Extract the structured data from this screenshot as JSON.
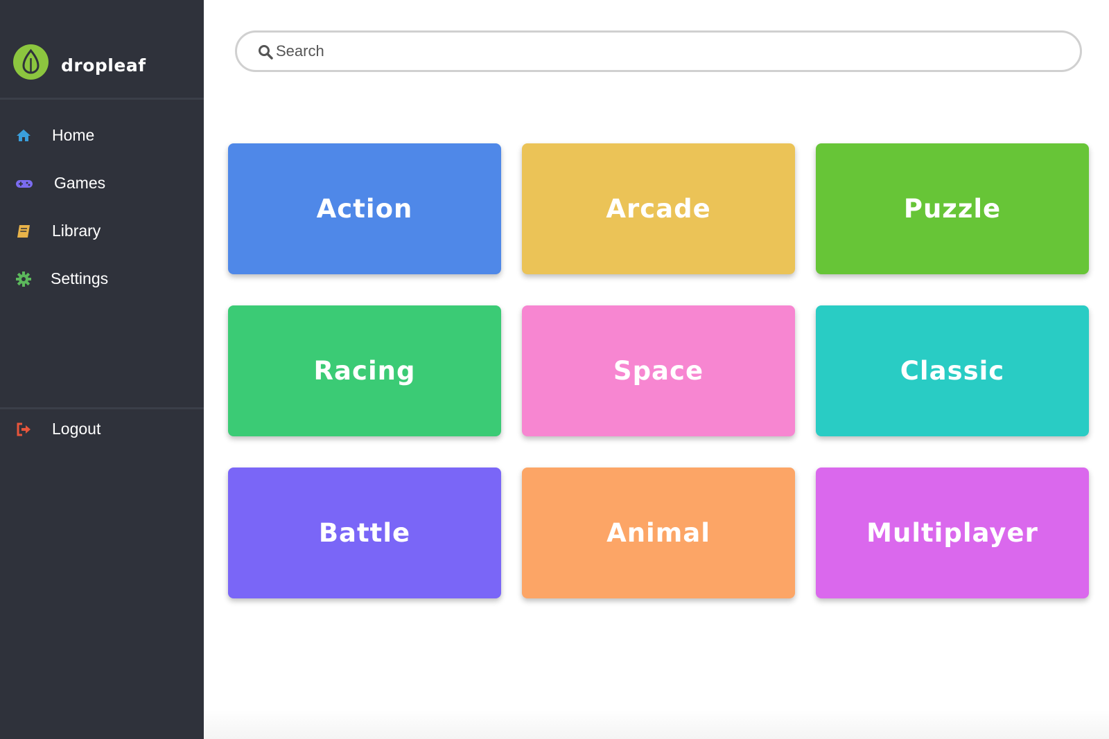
{
  "brand": {
    "name": "dropleaf",
    "logo_icon": "leaf-icon",
    "logo_color": "#8cc63f"
  },
  "sidebar": {
    "items": [
      {
        "label": "Home",
        "icon": "home-icon",
        "icon_color": "#3a9fdc"
      },
      {
        "label": "Games",
        "icon": "gamepad-icon",
        "icon_color": "#7b6cf0"
      },
      {
        "label": "Library",
        "icon": "book-icon",
        "icon_color": "#e8b34a"
      },
      {
        "label": "Settings",
        "icon": "gear-icon",
        "icon_color": "#5cb85c"
      }
    ],
    "logout": {
      "label": "Logout",
      "icon": "logout-icon",
      "icon_color": "#e8553b"
    }
  },
  "search": {
    "placeholder": "Search",
    "value": "",
    "icon": "search-icon"
  },
  "categories": [
    {
      "label": "Action",
      "color": "#4f88e8"
    },
    {
      "label": "Arcade",
      "color": "#ebc357"
    },
    {
      "label": "Puzzle",
      "color": "#67c537"
    },
    {
      "label": "Racing",
      "color": "#3bcb75"
    },
    {
      "label": "Space",
      "color": "#f786d1"
    },
    {
      "label": "Classic",
      "color": "#29ccc4"
    },
    {
      "label": "Battle",
      "color": "#7a66f7"
    },
    {
      "label": "Animal",
      "color": "#fca566"
    },
    {
      "label": "Multiplayer",
      "color": "#da68ed"
    }
  ]
}
